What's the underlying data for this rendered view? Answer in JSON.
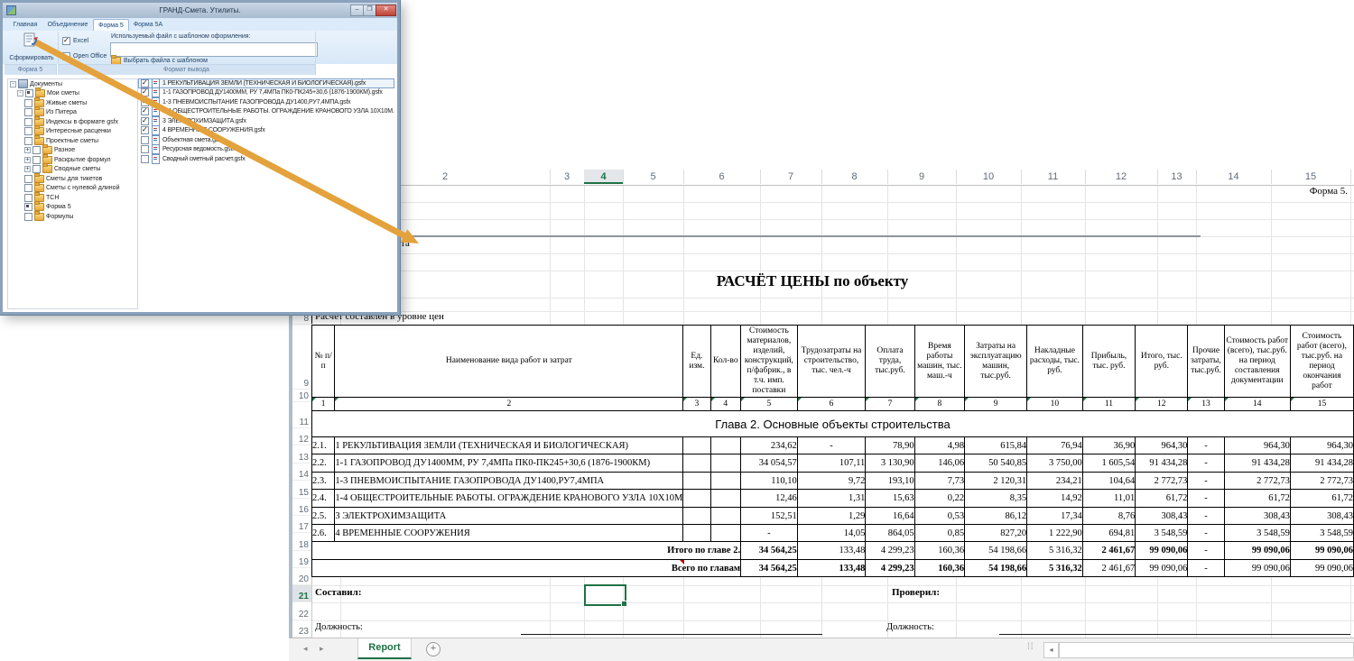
{
  "dialog": {
    "title": "ГРАНД-Смета. Утилиты.",
    "tabs": [
      {
        "label": "Главная",
        "active": false
      },
      {
        "label": "Объединение",
        "active": false
      },
      {
        "label": "Форма 5",
        "active": true
      },
      {
        "label": "Форма 5А",
        "active": false
      }
    ],
    "generate_button": "Сформировать",
    "format": {
      "excel_label": "Excel",
      "excel_checked": true,
      "openoffice_label": "Open Office",
      "openoffice_checked": false
    },
    "template_label": "Используемый файл с шаблоном оформления:",
    "template_value": "",
    "choose_button": "Выбрать файла с шаблоном",
    "group_footers": [
      "Форма 5",
      "Формат вывода"
    ],
    "tree": [
      {
        "label": "Документы",
        "lvl": 0,
        "exp": "-",
        "chk": "none",
        "icon": "docs"
      },
      {
        "label": "Мои сметы",
        "lvl": 1,
        "exp": "-",
        "chk": "filled",
        "icon": "folder"
      },
      {
        "label": "Живые сметы",
        "lvl": 2,
        "exp": "",
        "chk": "empty",
        "icon": "folder"
      },
      {
        "label": "Из Питера",
        "lvl": 2,
        "exp": "",
        "chk": "empty",
        "icon": "folder"
      },
      {
        "label": "Индексы в формате gsfx",
        "lvl": 2,
        "exp": "",
        "chk": "empty",
        "icon": "folder"
      },
      {
        "label": "Интересные расценки",
        "lvl": 2,
        "exp": "",
        "chk": "empty",
        "icon": "folder"
      },
      {
        "label": "Проектные сметы",
        "lvl": 2,
        "exp": "",
        "chk": "empty",
        "icon": "folder"
      },
      {
        "label": "Разное",
        "lvl": 2,
        "exp": "+",
        "chk": "empty",
        "icon": "folder"
      },
      {
        "label": "Раскрытие формул",
        "lvl": 2,
        "exp": "+",
        "chk": "empty",
        "icon": "folder"
      },
      {
        "label": "Сводные сметы",
        "lvl": 2,
        "exp": "+",
        "chk": "empty",
        "icon": "folder"
      },
      {
        "label": "Сметы для тикетов",
        "lvl": 2,
        "exp": "",
        "chk": "empty",
        "icon": "folder"
      },
      {
        "label": "Сметы с нулевой длиной",
        "lvl": 2,
        "exp": "",
        "chk": "empty",
        "icon": "folder"
      },
      {
        "label": "ТСН",
        "lvl": 2,
        "exp": "",
        "chk": "empty",
        "icon": "folder"
      },
      {
        "label": "Форма 5",
        "lvl": 2,
        "exp": "",
        "chk": "filled",
        "icon": "folder"
      },
      {
        "label": "Формулы",
        "lvl": 2,
        "exp": "",
        "chk": "empty",
        "icon": "folder"
      }
    ],
    "files": [
      {
        "label": "1 РЕКУЛЬТИВАЦИЯ ЗЕМЛИ (ТЕХНИЧЕСКАЯ И БИОЛОГИЧЕСКАЯ).gsfx",
        "checked": true,
        "selected": true
      },
      {
        "label": "1-1 ГАЗОПРОВОД ДУ1400ММ, РУ 7,4МПа ПК0-ПК245+30,6 (1876-1900КМ).gsfx",
        "checked": true,
        "selected": false
      },
      {
        "label": "1-3 ПНЕВМОИСПЫТАНИЕ ГАЗОПРОВОДА ДУ1400,РУ7,4МПА.gsfx",
        "checked": true,
        "selected": false
      },
      {
        "label": "1-4 ОБЩЕСТРОИТЕЛЬНЫЕ РАБОТЫ. ОГРАЖДЕНИЕ КРАНОВОГО УЗЛА 10X10М.gsfx",
        "checked": true,
        "selected": false
      },
      {
        "label": "3 ЭЛЕКТРОХИМЗАЩИТА.gsfx",
        "checked": true,
        "selected": false
      },
      {
        "label": "4 ВРЕМЕННЫЕ СООРУЖЕНИЯ.gsfx",
        "checked": true,
        "selected": false
      },
      {
        "label": "Объектная смета.gsfx",
        "checked": false,
        "selected": false
      },
      {
        "label": "Ресурсная ведомость.gsfx",
        "checked": false,
        "selected": false
      },
      {
        "label": "Сводный сметный расчет.gsfx",
        "checked": false,
        "selected": false
      }
    ]
  },
  "icons": {
    "minimize": "–",
    "maximize": "❒",
    "close": "✕",
    "nav_prev": "◂",
    "nav_next": "▸",
    "scroll_left": "◂",
    "plus": "+",
    "grip": "⁞⁞",
    "folder_open": "🗁"
  },
  "sheet": {
    "col_headers": [
      "2",
      "3",
      "4",
      "5",
      "6",
      "7",
      "8",
      "9",
      "10",
      "11",
      "12",
      "13",
      "14",
      "15"
    ],
    "selected_col": "4",
    "row_numbers": [
      "8",
      "9",
      "10",
      "11",
      "12",
      "13",
      "14",
      "15",
      "16",
      "17",
      "18",
      "19",
      "20",
      "21",
      "22",
      "23"
    ],
    "selected_row": "21",
    "forma_label": "Форма 5.",
    "clipped_text": "та",
    "title": "РАСЧЁТ ЦЕНЫ по объекту",
    "level_note": "Расчет составлен в уровне цен",
    "table": {
      "header": [
        "№ п/п",
        "Наименование вида работ и затрат",
        "Ед. изм.",
        "Кол-во",
        "Стоимость материалов, изделий, конструкций, п/фабрик., в т.ч. имп. поставки",
        "Трудозатраты на строительство, тыс. чел.-ч",
        "Оплата труда, тыс.руб.",
        "Время работы машин, тыс. маш.-ч",
        "Затраты на эксплуатацию машин, тыс.руб.",
        "Накладные расходы, тыс. руб.",
        "Прибыль, тыс. руб.",
        "Итого, тыс. руб.",
        "Прочие затраты, тыс.руб.",
        "Стоимость работ (всего), тыс.руб. на период составления документации",
        "Стоимость работ (всего), тыс.руб. на период окончания работ"
      ],
      "colnums": [
        "1",
        "2",
        "3",
        "4",
        "5",
        "6",
        "7",
        "8",
        "9",
        "10",
        "11",
        "12",
        "13",
        "14",
        "15"
      ],
      "chapter": "Глава 2. Основные объекты строительства",
      "rows": [
        {
          "num": "2.1.",
          "name": "1 РЕКУЛЬТИВАЦИЯ ЗЕМЛИ (ТЕХНИЧЕСКАЯ И БИОЛОГИЧЕСКАЯ)",
          "values": [
            "234,62",
            "-",
            "78,90",
            "4,98",
            "615,84",
            "76,94",
            "36,90",
            "964,30",
            "-",
            "964,30",
            "964,30"
          ]
        },
        {
          "num": "2.2.",
          "name": "1-1 ГАЗОПРОВОД ДУ1400ММ, РУ 7,4МПа ПК0-ПК245+30,6 (1876-1900КМ)",
          "values": [
            "34 054,57",
            "107,11",
            "3 130,90",
            "146,06",
            "50 540,85",
            "3 750,00",
            "1 605,54",
            "91 434,28",
            "-",
            "91 434,28",
            "91 434,28"
          ]
        },
        {
          "num": "2.3.",
          "name": "1-3 ПНЕВМОИСПЫТАНИЕ ГАЗОПРОВОДА ДУ1400,РУ7,4МПА",
          "values": [
            "110,10",
            "9,72",
            "193,10",
            "7,73",
            "2 120,31",
            "234,21",
            "104,64",
            "2 772,73",
            "-",
            "2 772,73",
            "2 772,73"
          ]
        },
        {
          "num": "2.4.",
          "name": "1-4 ОБЩЕСТРОИТЕЛЬНЫЕ РАБОТЫ. ОГРАЖДЕНИЕ КРАНОВОГО УЗЛА 10X10М",
          "values": [
            "12,46",
            "1,31",
            "15,63",
            "0,22",
            "8,35",
            "14,92",
            "11,01",
            "61,72",
            "-",
            "61,72",
            "61,72"
          ]
        },
        {
          "num": "2.5.",
          "name": "3 ЭЛЕКТРОХИМЗАЩИТА",
          "values": [
            "152,51",
            "1,29",
            "16,64",
            "0,53",
            "86,12",
            "17,34",
            "8,76",
            "308,43",
            "-",
            "308,43",
            "308,43"
          ]
        },
        {
          "num": "2.6.",
          "name": "4 ВРЕМЕННЫЕ СООРУЖЕНИЯ",
          "values": [
            "-",
            "14,05",
            "864,05",
            "0,85",
            "827,20",
            "1 222,90",
            "694,81",
            "3 548,59",
            "-",
            "3 548,59",
            "3 548,59"
          ]
        }
      ],
      "totals": [
        {
          "label": "Итого по главе 2.",
          "values": [
            "34 564,25",
            "133,48",
            "4 299,23",
            "160,36",
            "54 198,66",
            "5 316,32",
            "2 461,67",
            "99 090,06",
            "-",
            "99 090,06",
            "99 090,06"
          ],
          "bold": [
            1,
            0,
            0,
            0,
            0,
            0,
            1,
            1,
            0,
            1,
            1
          ]
        },
        {
          "label": "Всего по главам",
          "values": [
            "34 564,25",
            "133,48",
            "4 299,23",
            "160,36",
            "54 198,66",
            "5 316,32",
            "2 461,67",
            "99 090,06",
            "-",
            "99 090,06",
            "99 090,06"
          ],
          "bold": [
            1,
            1,
            1,
            1,
            1,
            1,
            0,
            0,
            0,
            0,
            0
          ]
        }
      ]
    },
    "footer": {
      "compiled": "Составил:",
      "verified": "Проверил:",
      "position_left": "Должность:",
      "position_right": "Должность:"
    },
    "tabbar": {
      "sheet_tab": "Report"
    }
  }
}
